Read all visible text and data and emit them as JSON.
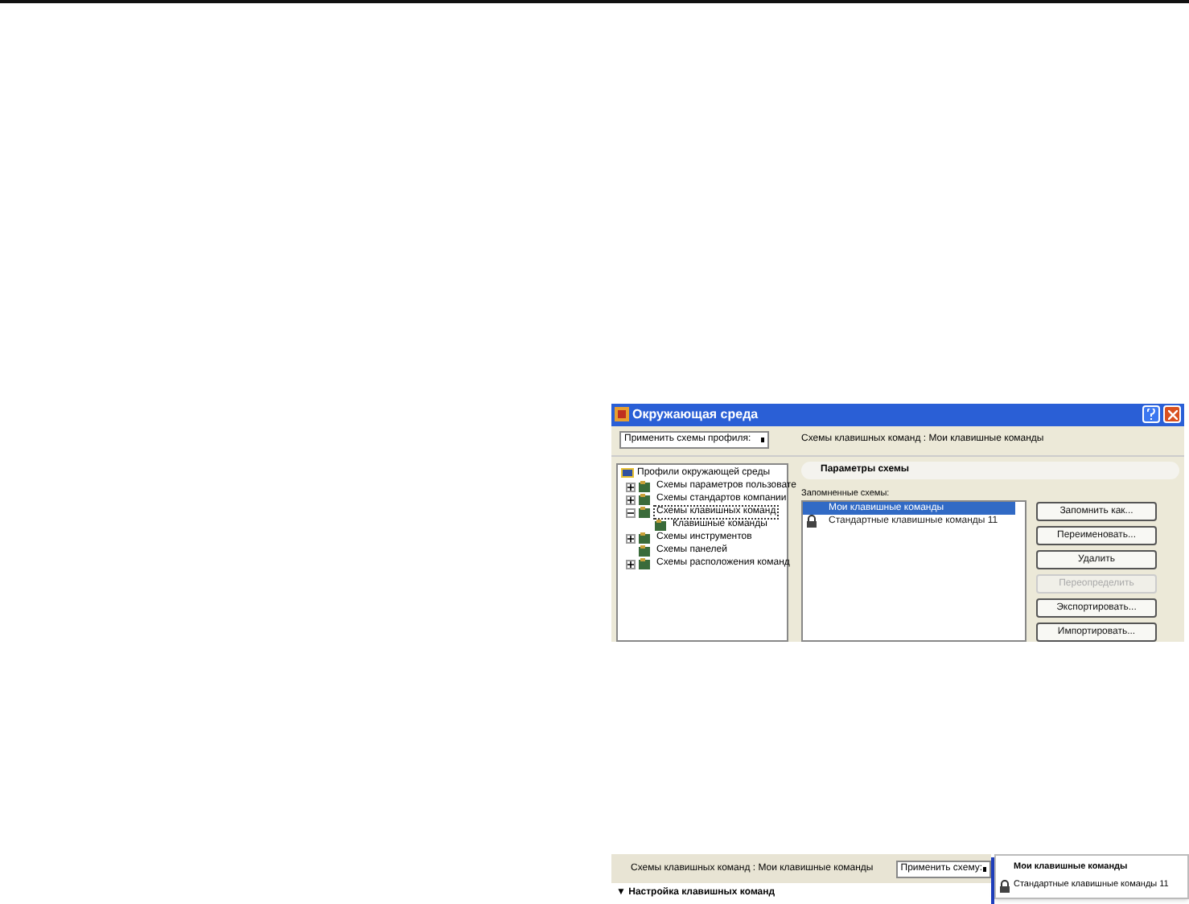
{
  "dialog": {
    "title": "Окружающая среда",
    "profile_dropdown": "Применить схемы профиля:",
    "path": "Схемы клавишных команд : Мои клавишные команды",
    "tree": {
      "label": "Профили окружающей среды",
      "children": [
        {
          "label": "Схемы параметров пользовате",
          "kind": "collapsed",
          "focused": false
        },
        {
          "label": "Схемы стандартов компании",
          "kind": "collapsed",
          "focused": false
        },
        {
          "label": "Схемы клавишных команд",
          "kind": "expanded",
          "focused": true,
          "children": [
            {
              "label": "Клавишные команды",
              "focused": false
            }
          ]
        },
        {
          "label": "Схемы инструментов",
          "kind": "collapsed",
          "focused": false
        },
        {
          "label": "Схемы панелей",
          "kind": "leaf",
          "focused": false
        },
        {
          "label": "Схемы расположения команд",
          "kind": "collapsed",
          "focused": false
        }
      ]
    },
    "section_header": "Параметры схемы",
    "list_label": "Запомненные схемы:",
    "schemes": [
      {
        "label": "Мои клавишные команды",
        "selected": true,
        "locked": false
      },
      {
        "label": "Стандартные клавишные команды 11",
        "selected": false,
        "locked": true
      }
    ],
    "buttons": [
      {
        "label": "Запомнить как...",
        "disabled": false
      },
      {
        "label": "Переименовать...",
        "disabled": false
      },
      {
        "label": "Удалить",
        "disabled": false
      },
      {
        "label": "Переопределить",
        "disabled": true
      },
      {
        "label": "Экспортировать...",
        "disabled": false
      },
      {
        "label": "Импортировать...",
        "disabled": false
      }
    ]
  },
  "strip": {
    "path": "Схемы клавишных команд : Мои клавишные команды",
    "dropdown": "Применить схему:",
    "section": "▼ Настройка клавишных команд",
    "menu": [
      {
        "label": "Мои клавишные команды",
        "selected": true,
        "locked": false
      },
      {
        "label": "Стандартные клавишные команды 11",
        "selected": false,
        "locked": true
      }
    ]
  }
}
